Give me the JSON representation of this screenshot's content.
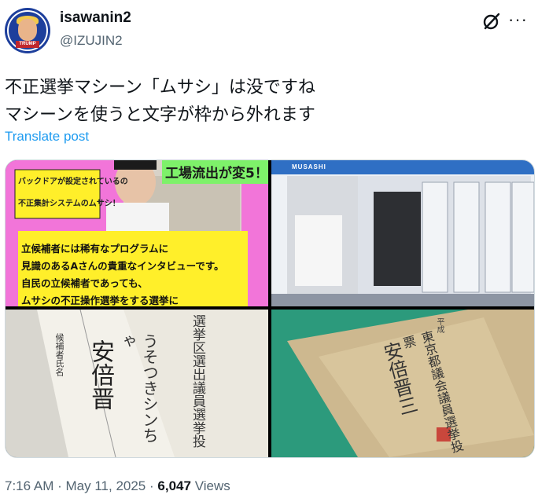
{
  "author": {
    "name": "isawanin2",
    "handle": "@IZUJIN2",
    "avatar_badge": "TRUMP"
  },
  "icons": {
    "grok": "grok-icon",
    "more": "more-icon"
  },
  "tweet": {
    "line1": "不正選挙マシーン「ムサシ」は没ですね",
    "line2": "マシーンを使うと文字が枠から外れます",
    "translate_label": "Translate post"
  },
  "media": {
    "image1": {
      "banner_top": "工場流出が変5！",
      "label_a": "バックドアが設定されているの",
      "label_b": "不正集計システムのムサシ！",
      "caption1": "立候補者には稀有なプログラムに",
      "caption2": "見識のあるAさんの貴重なインタビューです。",
      "caption3": "自民の立候補者であっても、",
      "caption4": "ムサシの不正操作選挙をする選挙に"
    },
    "image2": {
      "machine_label": "MUSASHI"
    },
    "image3": {
      "stamp": "候補者氏名",
      "handwriting1": "安倍晋",
      "handwriting2": "うそつきシンちゃ",
      "printed": "選挙区選出議員選挙投"
    },
    "image4": {
      "printed1": "東京都議会議員選挙投票",
      "printed2": "平成",
      "handwriting": "安倍晋三"
    }
  },
  "meta": {
    "time": "7:16 AM",
    "sep1": "·",
    "date": "May 11, 2025",
    "sep2": "·",
    "views_count": "6,047",
    "views_label": "Views"
  }
}
